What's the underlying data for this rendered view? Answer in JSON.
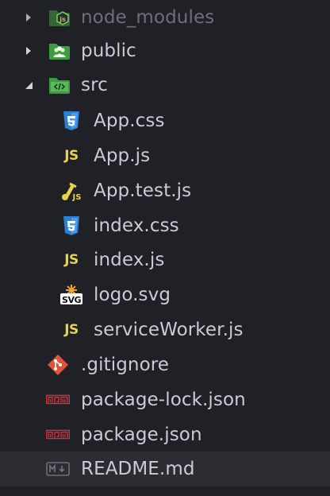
{
  "tree": {
    "node_modules": {
      "label": "node_modules",
      "icon": "nodejs-folder-icon",
      "expanded": false
    },
    "public": {
      "label": "public",
      "icon": "public-folder-icon",
      "expanded": false
    },
    "src": {
      "label": "src",
      "icon": "src-folder-icon",
      "expanded": true
    },
    "src_files": {
      "app_css": {
        "label": "App.css",
        "icon": "css3-file-icon"
      },
      "app_js": {
        "label": "App.js",
        "icon": "js-file-icon",
        "badge": "JS"
      },
      "app_test_js": {
        "label": "App.test.js",
        "icon": "js-test-file-icon"
      },
      "index_css": {
        "label": "index.css",
        "icon": "css3-file-icon"
      },
      "index_js": {
        "label": "index.js",
        "icon": "js-file-icon",
        "badge": "JS"
      },
      "logo_svg": {
        "label": "logo.svg",
        "icon": "svg-file-icon",
        "badge": "SVG"
      },
      "service_worker_js": {
        "label": "serviceWorker.js",
        "icon": "js-file-icon",
        "badge": "JS"
      }
    },
    "root_files": {
      "gitignore": {
        "label": ".gitignore",
        "icon": "git-file-icon"
      },
      "package_lock": {
        "label": "package-lock.json",
        "icon": "npm-file-icon",
        "badge": "npm"
      },
      "package_json": {
        "label": "package.json",
        "icon": "npm-file-icon",
        "badge": "npm"
      },
      "readme": {
        "label": "README.md",
        "icon": "markdown-file-icon",
        "badge": "M↓",
        "selected": true
      }
    }
  },
  "colors": {
    "background": "#1f2126",
    "selected_row": "#2b2d33",
    "text": "#c8ccd4",
    "text_dim": "#6b7079",
    "js_yellow": "#e8d24a",
    "css_blue": "#2d7fd3",
    "folder_green": "#4caf50",
    "git_red": "#e0533b",
    "npm_red": "#c6343a"
  }
}
